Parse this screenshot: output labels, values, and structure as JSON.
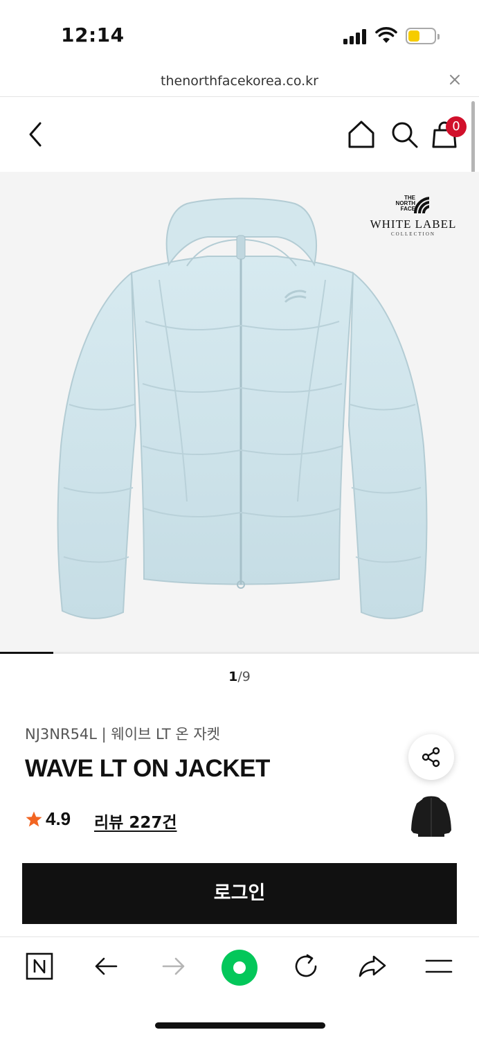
{
  "status_bar": {
    "time": "12:14"
  },
  "browser": {
    "url": "thenorthfacekorea.co.kr"
  },
  "header": {
    "cart_count": "0"
  },
  "product": {
    "brand_logo": {
      "top": "THE NORTH FACE",
      "line1": "WHITE LABEL",
      "line2": "COLLECTION"
    },
    "image_index": "1",
    "image_total": "9",
    "image_progress": 0.111,
    "code_and_name_ko": "NJ3NR54L | 웨이브 LT 온 자켓",
    "name": "WAVE LT ON JACKET",
    "rating": "4.9",
    "review_label": "리뷰 227건",
    "jacket_color": "#cfe4ea"
  },
  "actions": {
    "login_label": "로그인"
  },
  "colors": {
    "accent": "#111111",
    "badge": "#d1102b",
    "naver_green": "#03c75a"
  }
}
